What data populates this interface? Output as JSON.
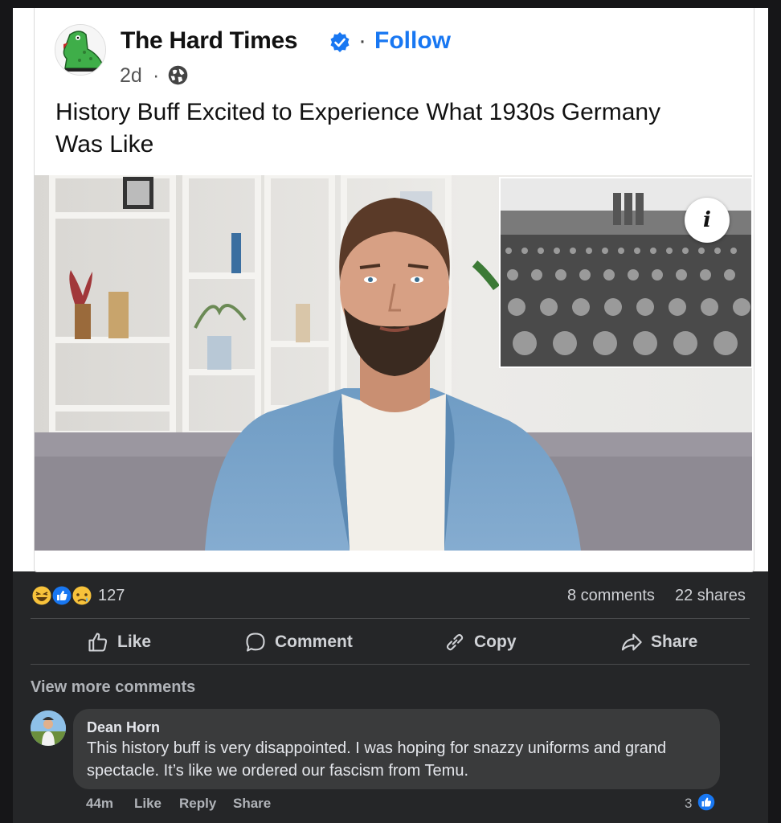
{
  "post": {
    "page_name": "The Hard Times",
    "follow_label": "Follow",
    "dot": "·",
    "time": "2d",
    "headline": "History Buff Excited to Experience What 1930s Germany Was Like",
    "info_glyph": "i"
  },
  "stats": {
    "reaction_count": "127",
    "comments": "8 comments",
    "shares": "22 shares",
    "reactions": [
      "haha-emoji",
      "like-emoji",
      "sad-emoji"
    ]
  },
  "actions": {
    "like": "Like",
    "comment": "Comment",
    "copy": "Copy",
    "share": "Share"
  },
  "comments": {
    "view_more": "View more comments",
    "items": [
      {
        "author": "Dean Horn",
        "text": "This history buff is very disappointed. I was hoping for snazzy uniforms and grand spectacle. It’s like we ordered our fascism from Temu.",
        "time": "44m",
        "like_label": "Like",
        "reply_label": "Reply",
        "share_label": "Share",
        "like_count": "3"
      }
    ]
  },
  "colors": {
    "accent": "#1877f2",
    "dark_bg": "#252628",
    "bubble": "#3a3b3c"
  }
}
